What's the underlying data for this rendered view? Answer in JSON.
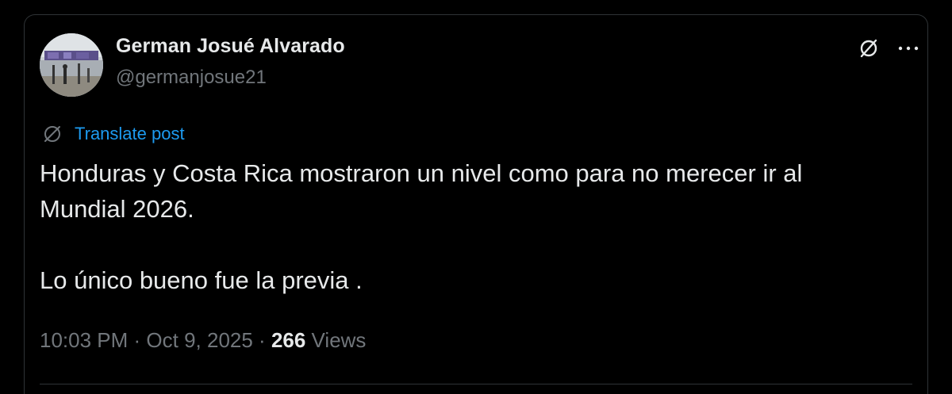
{
  "author": {
    "display_name": "German Josué Alvarado",
    "handle": "@germanjosue21",
    "avatar_icon": "profile-photo"
  },
  "actions": {
    "grok_icon": "grok-icon",
    "more_icon": "more-horizontal-icon",
    "more_label": "···"
  },
  "translate": {
    "icon": "translate-globe-icon",
    "label": "Translate post"
  },
  "post": {
    "line1": "Honduras y Costa Rica mostraron un nivel como para no merecer ir al",
    "line2": "Mundial 2026.",
    "line3": "Lo único bueno fue la previa ."
  },
  "meta": {
    "time": "10:03 PM",
    "separator1": " · ",
    "date": "Oct 9, 2025",
    "separator2": " · ",
    "views_count": "266",
    "views_label": " Views"
  },
  "colors": {
    "background": "#000000",
    "text_primary": "#e7e9ea",
    "text_secondary": "#71767b",
    "accent": "#1d9bf0",
    "border": "#2f3336"
  }
}
